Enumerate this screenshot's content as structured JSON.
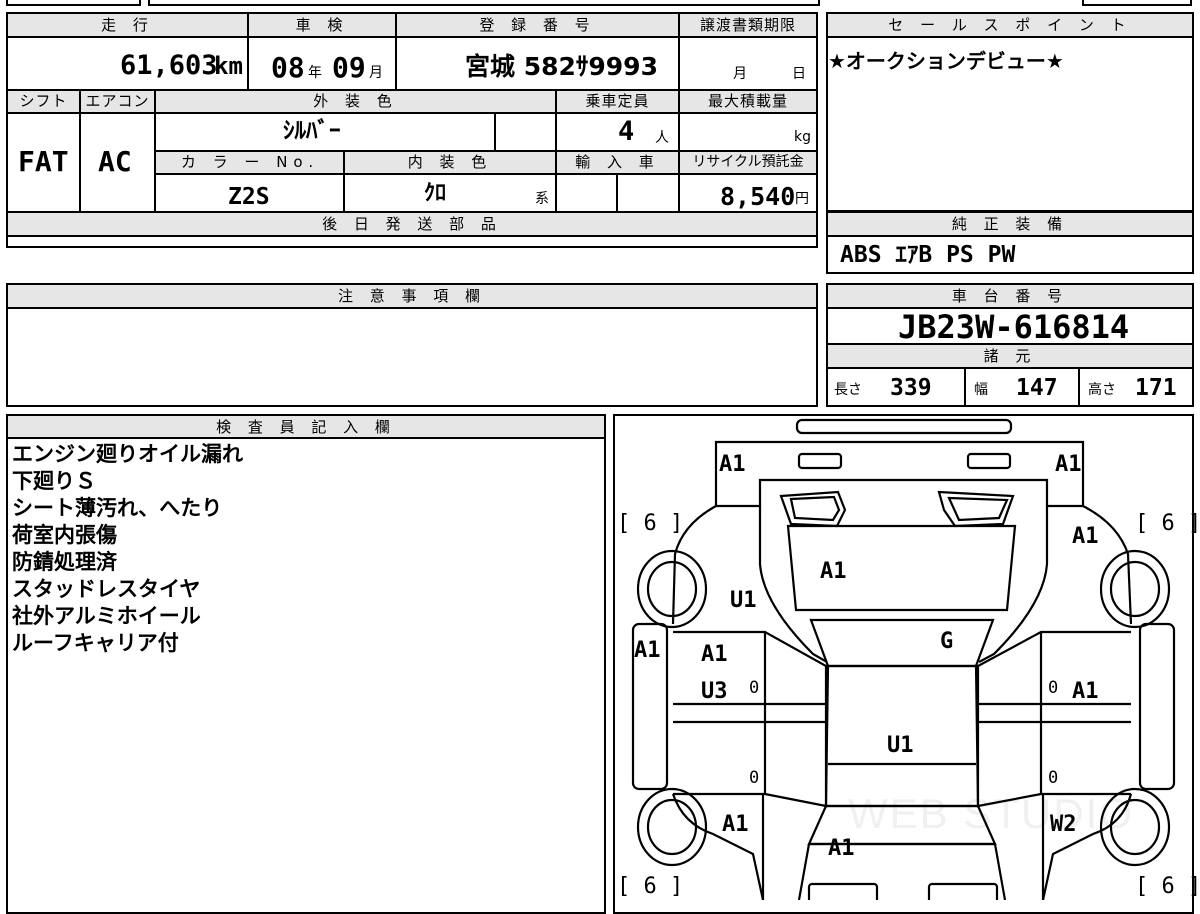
{
  "header": {
    "mileage_label": "走 行",
    "mileage_value": "61,603",
    "mileage_unit": "km",
    "inspection_label": "車 検",
    "inspection_year": "08",
    "inspection_year_unit": "年",
    "inspection_month": "09",
    "inspection_month_unit": "月",
    "registration_label": "登 録 番 号",
    "registration_value": "宮城 582ｻ9993",
    "transfer_label": "譲渡書類期限",
    "transfer_month_unit": "月",
    "transfer_day_unit": "日",
    "shift_label": "シフト",
    "shift_value": "FAT",
    "aircon_label": "エアコン",
    "aircon_value": "AC",
    "exterior_label": "外 装 色",
    "exterior_value": "ｼﾙﾊﾞｰ",
    "capacity_label": "乗車定員",
    "capacity_value": "4",
    "capacity_unit": "人",
    "maxload_label": "最大積載量",
    "maxload_unit": "kg",
    "color_no_label": "カ ラ ー No.",
    "color_no_value": "Z2S",
    "interior_label": "内 装 色",
    "interior_value": "ｸﾛ",
    "interior_unit": "系",
    "import_label": "輸 入 車",
    "recycle_label": "リサイクル預託金",
    "recycle_value": "8,540",
    "recycle_unit": "円",
    "later_parts_label": "後 日 発 送 部 品"
  },
  "sales": {
    "label": "セ ー ル ス ポ イ ン ト",
    "text": "★オークションデビュー★"
  },
  "equipment": {
    "label": "純 正 装 備",
    "value": "ABS ｴｱB PS PW"
  },
  "notes": {
    "label": "注 意 事 項 欄"
  },
  "chassis": {
    "label": "車 台 番 号",
    "value": "JB23W-616814",
    "specs_label": "諸 元",
    "length_label": "長さ",
    "length_value": "339",
    "width_label": "幅",
    "width_value": "147",
    "height_label": "高さ",
    "height_value": "171"
  },
  "inspector": {
    "label": "検 査 員 記 入 欄",
    "lines": [
      "エンジン廻りオイル漏れ",
      "下廻りＳ",
      "シート薄汚れ、へたり",
      "荷室内張傷",
      "防錆処理済",
      "スタッドレスタイヤ",
      "社外アルミホイール",
      "ルーフキャリア付"
    ]
  },
  "diagram": {
    "marks": {
      "rear_left": "A1",
      "rear_right": "A1",
      "tire_fl": "[ 6 ]",
      "tire_fr": "[ 6 ]",
      "tire_rl": "[ 6 ]",
      "tire_rr": "[ 6 ]",
      "rear_quarter_right": "A1",
      "tailgate": "A1",
      "rear_quarter_left": "U1",
      "side_left": "A1",
      "door_left_rear": "A1",
      "door_left_rear_2": "U3",
      "roof_glass": "G",
      "door_right_rear": "A1",
      "roof": "U1",
      "fender_left": "A1",
      "hood": "A1",
      "fender_right": "W2",
      "zero_1": "0",
      "zero_2": "0",
      "zero_3": "0",
      "zero_4": "0"
    },
    "watermark": "WEB STUDIO"
  }
}
